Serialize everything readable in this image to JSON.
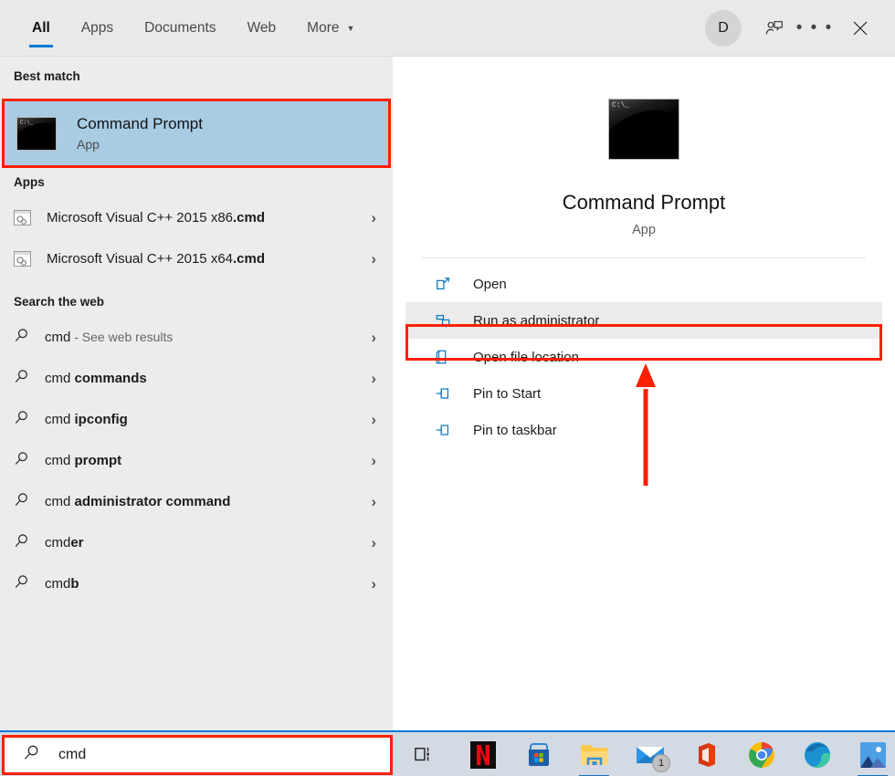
{
  "tabs": [
    {
      "label": "All",
      "active": true
    },
    {
      "label": "Apps",
      "active": false
    },
    {
      "label": "Documents",
      "active": false
    },
    {
      "label": "Web",
      "active": false
    },
    {
      "label": "More",
      "active": false,
      "caret": "▼"
    }
  ],
  "titlebar": {
    "avatar_initial": "D",
    "feedback_icon": "feedback-person-icon",
    "more_icon": "ellipsis-icon",
    "more_glyph": "• • •",
    "close_icon": "close-icon"
  },
  "left": {
    "best_match_header": "Best match",
    "best_match": {
      "title": "Command Prompt",
      "subtitle": "App",
      "icon": "command-prompt-icon",
      "icon_text": "C:\\_"
    },
    "apps_header": "Apps",
    "apps": [
      {
        "prefix": "Microsoft Visual C++ 2015 x86",
        "bold": ".cmd",
        "chevron": "›"
      },
      {
        "prefix": "Microsoft Visual C++ 2015 x64",
        "bold": ".cmd",
        "chevron": "›"
      }
    ],
    "web_header": "Search the web",
    "web": [
      {
        "prefix": "cmd",
        "bold": "",
        "suffix": " - See web results",
        "chevron": "›"
      },
      {
        "prefix": "cmd ",
        "bold": "commands",
        "suffix": "",
        "chevron": "›"
      },
      {
        "prefix": "cmd ",
        "bold": "ipconfig",
        "suffix": "",
        "chevron": "›"
      },
      {
        "prefix": "cmd ",
        "bold": "prompt",
        "suffix": "",
        "chevron": "›"
      },
      {
        "prefix": "cmd ",
        "bold": "administrator command",
        "suffix": "",
        "chevron": "›"
      },
      {
        "prefix": "cmd",
        "bold": "er",
        "suffix": "",
        "chevron": "›"
      },
      {
        "prefix": "cmd",
        "bold": "b",
        "suffix": "",
        "chevron": "›"
      }
    ]
  },
  "right": {
    "app_title": "Command Prompt",
    "app_type": "App",
    "icon_text": "C:\\_",
    "actions": [
      {
        "label": "Open",
        "icon": "open-external-icon",
        "highlighted": false
      },
      {
        "label": "Run as administrator",
        "icon": "shield-icon",
        "highlighted": true
      },
      {
        "label": "Open file location",
        "icon": "folder-open-icon",
        "highlighted": false
      },
      {
        "label": "Pin to Start",
        "icon": "pin-icon",
        "highlighted": false
      },
      {
        "label": "Pin to taskbar",
        "icon": "pin-icon",
        "highlighted": false
      }
    ]
  },
  "taskbar": {
    "search_value": "cmd",
    "search_icon": "search-icon",
    "taskview_icon": "task-view-icon",
    "apps": [
      {
        "name": "netflix",
        "active": false
      },
      {
        "name": "microsoft-store",
        "active": false
      },
      {
        "name": "file-explorer",
        "active": true
      },
      {
        "name": "mail",
        "active": false,
        "badge": "1"
      },
      {
        "name": "office",
        "active": false
      },
      {
        "name": "google-chrome",
        "active": false
      },
      {
        "name": "microsoft-edge",
        "active": false
      },
      {
        "name": "photos",
        "active": true
      }
    ]
  },
  "annotations": {
    "accent_color": "#fa2000",
    "selection_color": "#a9cce3",
    "brand_blue": "#0078d4"
  }
}
